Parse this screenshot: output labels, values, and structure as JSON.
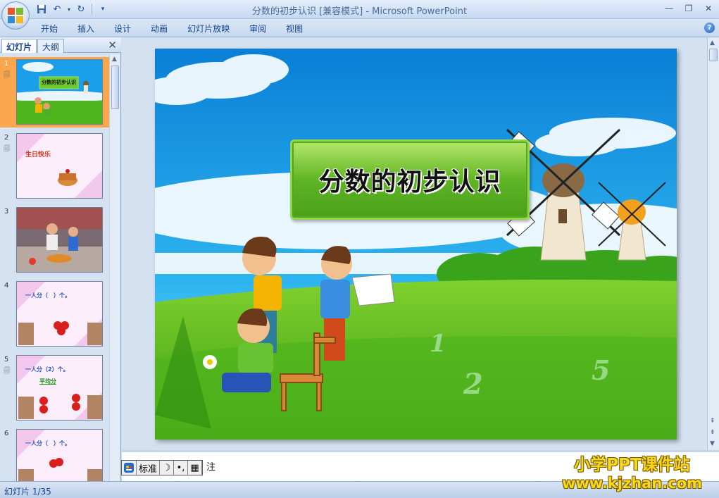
{
  "window": {
    "title": "分数的初步认识 [兼容模式] - Microsoft PowerPoint"
  },
  "quick_access": {
    "icons": [
      "save-icon",
      "undo-icon",
      "redo-icon",
      "customize-icon"
    ]
  },
  "ribbon": {
    "tabs": [
      {
        "label": "开始"
      },
      {
        "label": "插入"
      },
      {
        "label": "设计"
      },
      {
        "label": "动画"
      },
      {
        "label": "幻灯片放映"
      },
      {
        "label": "审阅"
      },
      {
        "label": "视图"
      }
    ]
  },
  "panel": {
    "tab_slides": "幻灯片",
    "tab_outline": "大纲"
  },
  "thumbnails": [
    {
      "number": "1",
      "anim": "🗐",
      "caption": "分数的初步认识"
    },
    {
      "number": "2",
      "anim": "🗐",
      "caption": "生日快乐"
    },
    {
      "number": "3",
      "anim": "",
      "caption": ""
    },
    {
      "number": "4",
      "anim": "",
      "caption": "一人分（　）个。"
    },
    {
      "number": "5",
      "anim": "🗐",
      "caption": "一人分（2）个。",
      "caption2": "平均分"
    },
    {
      "number": "6",
      "anim": "",
      "caption": "一人分（　）个。"
    }
  ],
  "slide": {
    "title": "分数的初步认识"
  },
  "notes": {
    "hint": "注"
  },
  "ime": {
    "mode": "标准",
    "cells": [
      "☽",
      "•,",
      "▦"
    ]
  },
  "watermark": {
    "line1": "小学PPT课件站",
    "line2": "www.kjzhan.com"
  },
  "status": {
    "text": "幻灯片 1/35"
  },
  "colors": {
    "selected_thumb": "#f9a64c",
    "sky": "#1aa0ea",
    "grass": "#4fb51c"
  }
}
